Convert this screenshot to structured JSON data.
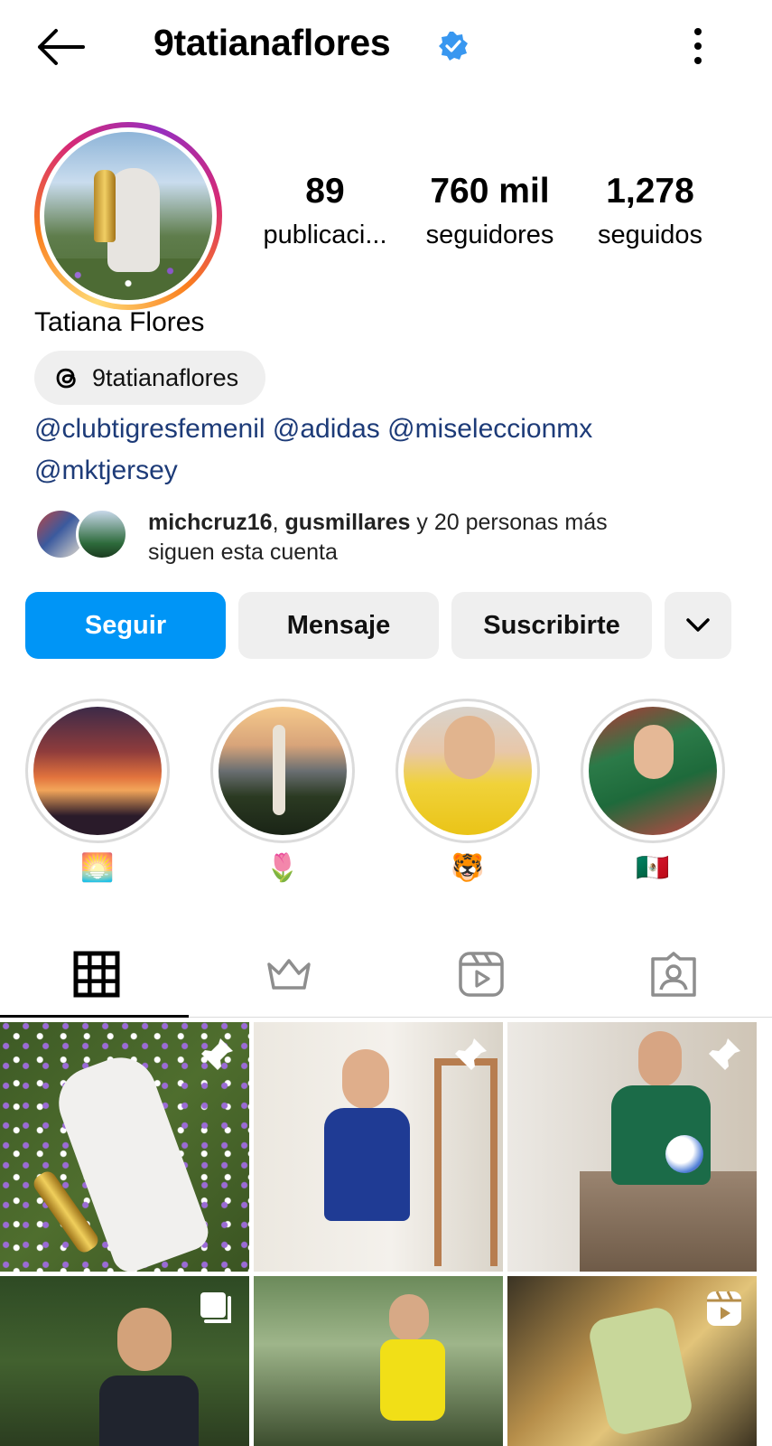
{
  "header": {
    "username": "9tatianaflores",
    "back_icon": "arrow-left-icon",
    "verified_icon": "verified-badge-icon",
    "more_icon": "more-vertical-icon",
    "verified_color": "#3897f0"
  },
  "profile": {
    "full_name": "Tatiana Flores",
    "stats": {
      "posts_value": "89",
      "posts_label": "publicaci...",
      "followers_value": "760 mil",
      "followers_label": "seguidores",
      "following_value": "1,278",
      "following_label": "seguidos"
    },
    "threads_handle": "9tatianaflores",
    "bio_links": [
      "@clubtigresfemenil",
      "@adidas",
      "@miseleccionmx",
      "@mktjersey"
    ],
    "mutuals": {
      "user1": "michcruz16",
      "user2": "gusmillares",
      "rest": "y 20 personas más",
      "line2": "siguen esta cuenta"
    }
  },
  "actions": {
    "follow": "Seguir",
    "message": "Mensaje",
    "subscribe": "Suscribirte",
    "more_icon": "chevron-down-icon",
    "follow_color": "#0095f6"
  },
  "highlights": [
    {
      "label": "🌅"
    },
    {
      "label": "🌷"
    },
    {
      "label": "🐯"
    },
    {
      "label": "🇲🇽"
    }
  ],
  "tabs": [
    {
      "icon": "grid-icon",
      "active": true
    },
    {
      "icon": "crown-icon",
      "active": false
    },
    {
      "icon": "reels-icon",
      "active": false
    },
    {
      "icon": "tagged-icon",
      "active": false
    }
  ],
  "posts": [
    {
      "badge": "pin-icon"
    },
    {
      "badge": "pin-icon"
    },
    {
      "badge": "pin-icon"
    },
    {
      "badge": "carousel-icon"
    },
    {
      "badge": ""
    },
    {
      "badge": "reel-icon"
    }
  ]
}
